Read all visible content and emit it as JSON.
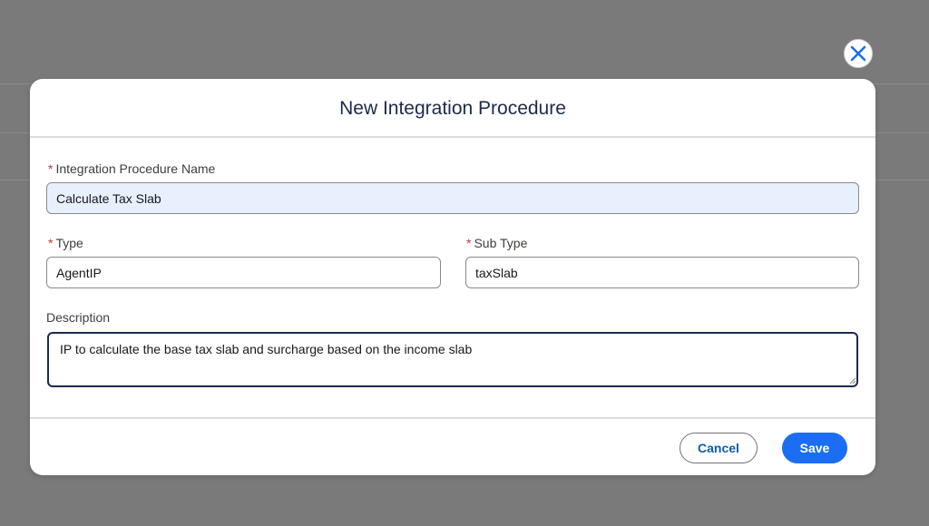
{
  "modal": {
    "title": "New Integration Procedure",
    "close_icon": "close-icon",
    "fields": {
      "name": {
        "label": "Integration Procedure Name",
        "required_marker": "*",
        "value": "Calculate Tax Slab"
      },
      "type": {
        "label": "Type",
        "required_marker": "*",
        "value": "AgentIP"
      },
      "sub_type": {
        "label": "Sub Type",
        "required_marker": "*",
        "value": "taxSlab"
      },
      "description": {
        "label": "Description",
        "value": "IP to calculate the base tax slab and surcharge based on the income slab"
      }
    },
    "footer": {
      "cancel_label": "Cancel",
      "save_label": "Save"
    }
  },
  "colors": {
    "overlay": "#7a7a7a",
    "primary": "#1b6ef3",
    "required": "#c23934",
    "title": "#1c2a4a"
  }
}
